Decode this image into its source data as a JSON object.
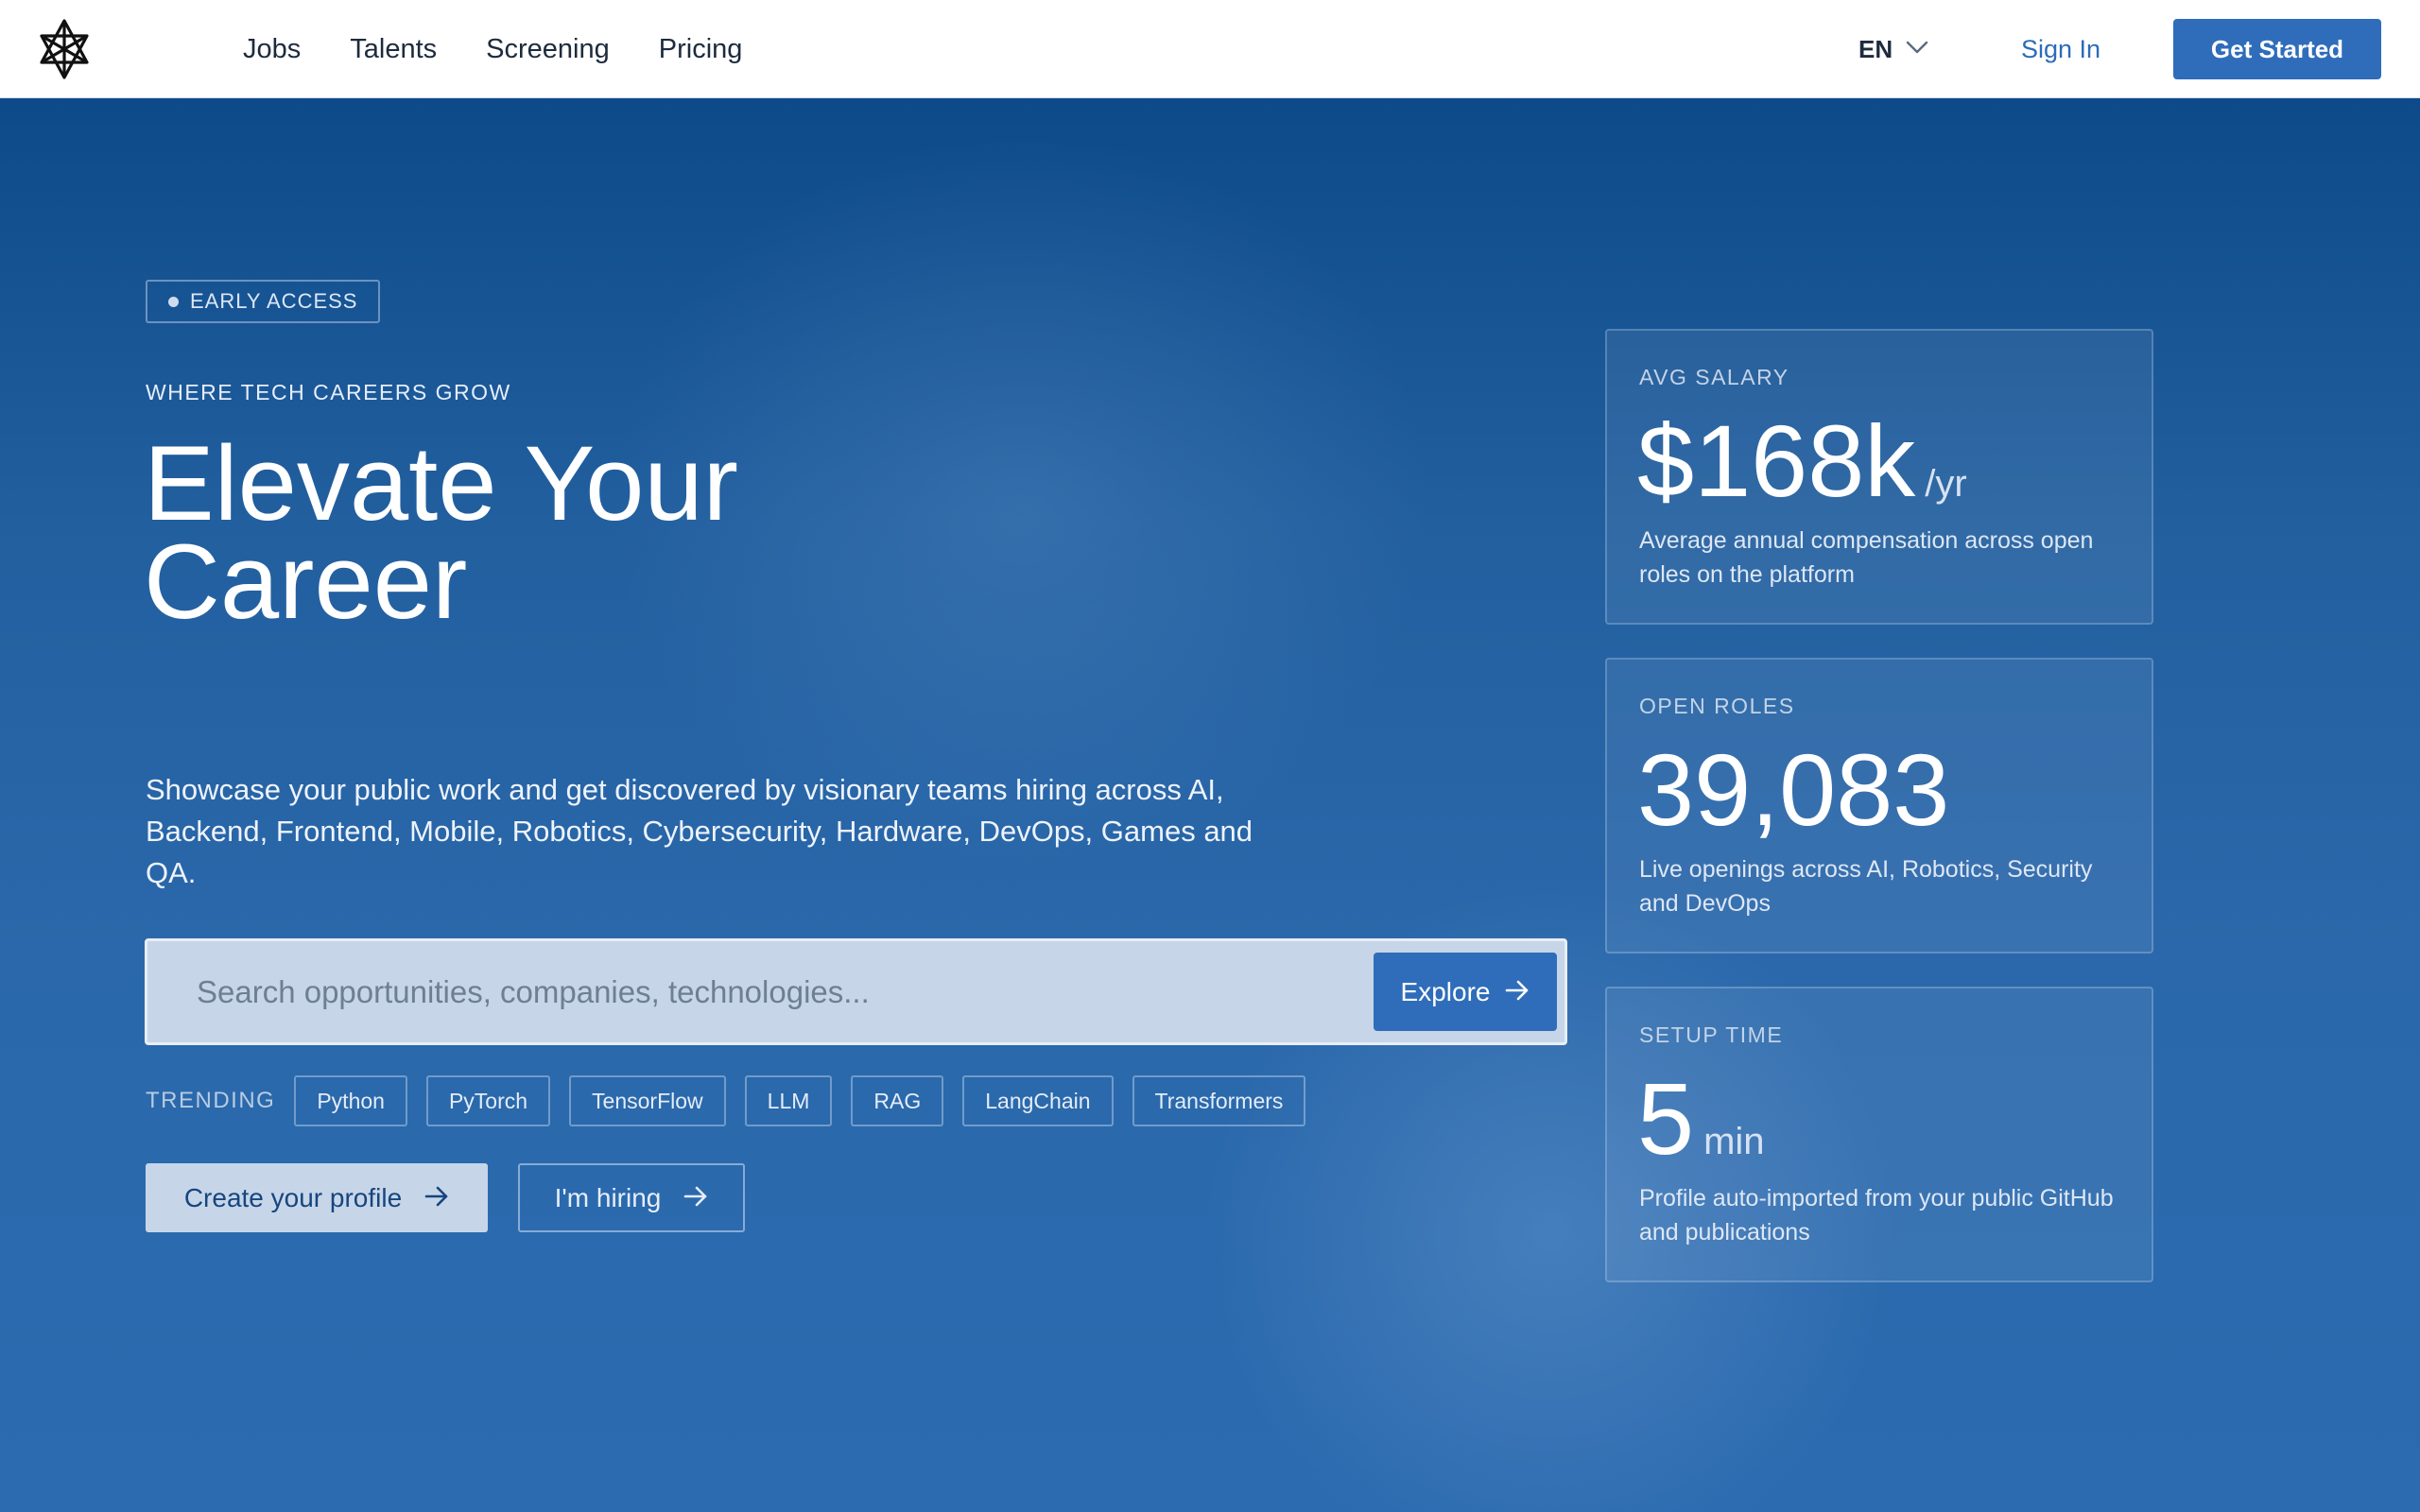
{
  "nav": {
    "items": [
      "Jobs",
      "Talents",
      "Screening",
      "Pricing"
    ],
    "language": "EN",
    "signin_label": "Sign In",
    "cta_label": "Get Started"
  },
  "hero": {
    "badge": "EARLY ACCESS",
    "eyebrow": "WHERE TECH CAREERS GROW",
    "headline_line1": "Elevate Your",
    "headline_line2": "Career",
    "subtitle": "Showcase your public work and get discovered by visionary teams hiring across AI, Backend, Frontend, Mobile, Robotics, Cybersecurity, Hardware, DevOps, Games and QA.",
    "search": {
      "placeholder": "Search opportunities, companies, technologies...",
      "value": "",
      "button_label": "Explore"
    },
    "trending": {
      "label": "TRENDING",
      "tags": [
        "Python",
        "PyTorch",
        "TensorFlow",
        "LLM",
        "RAG",
        "LangChain",
        "Transformers"
      ]
    },
    "cta_primary": "Create your profile",
    "cta_secondary": "I'm hiring"
  },
  "stats": [
    {
      "label": "AVG SALARY",
      "value": "$168k",
      "unit": "/yr",
      "description": "Average annual compensation across open roles on the platform"
    },
    {
      "label": "OPEN ROLES",
      "value": "39,083",
      "unit": "",
      "description": "Live openings across AI, Robotics, Security and DevOps"
    },
    {
      "label": "SETUP TIME",
      "value": "5",
      "unit": "min",
      "description": "Profile auto-imported from your public GitHub and publications"
    }
  ],
  "icons": {
    "logo": "hexagram-logo-icon",
    "language_chevron": "chevron-down-icon",
    "arrow": "arrow-right-icon"
  },
  "colors": {
    "brand_blue": "#2f6dbb",
    "hero_top": "#0d4a8a",
    "hero_bottom": "#2c6bb0"
  }
}
